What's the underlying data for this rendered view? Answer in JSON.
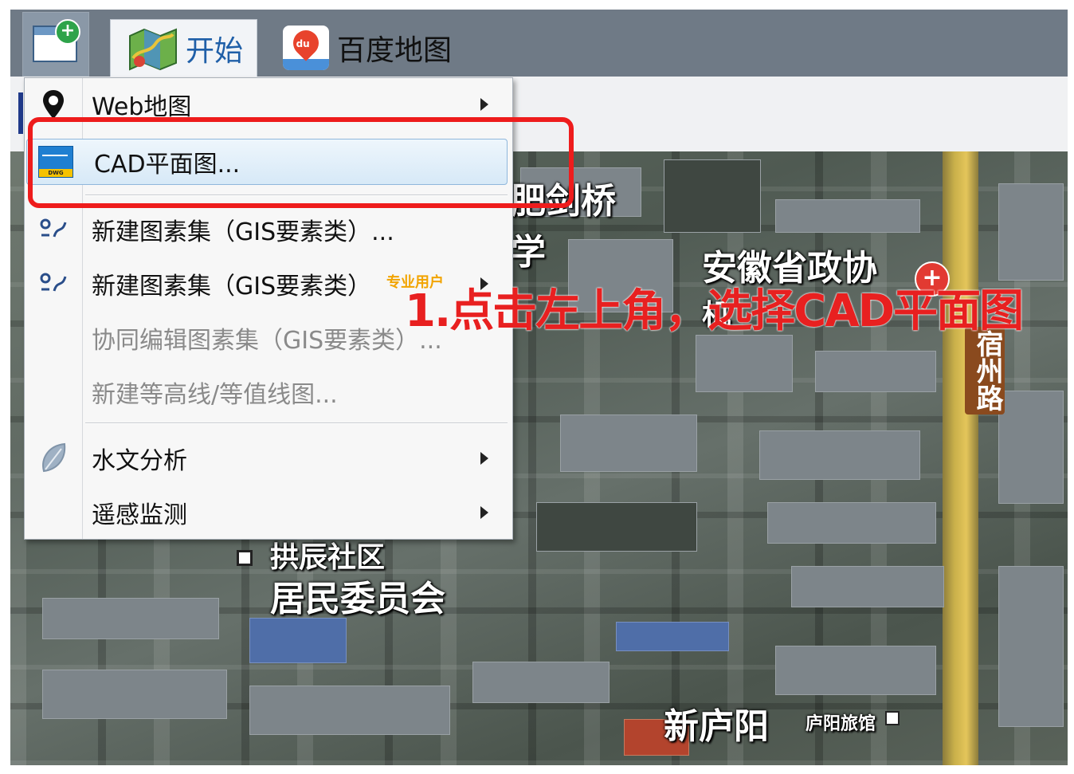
{
  "tabs": {
    "start": "开始",
    "baidu": "百度地图"
  },
  "menu": {
    "web_map": "Web地图",
    "cad_plan": "CAD平面图...",
    "new_feature_set": "新建图素集（GIS要素类）...",
    "new_feature_set_pro": "新建图素集（GIS要素类）",
    "pro_badge": "专业用户",
    "collab_edit": "协同编辑图素集（GIS要素类）...",
    "new_contour": "新建等高线/等值线图...",
    "hydro_analysis": "水文分析",
    "remote_sensing": "遥感监测"
  },
  "annotation": "1.点击左上角，选择CAD平面图",
  "map_labels": {
    "bridge": "肥剑桥",
    "school": "学",
    "cppcc": "安徽省政协",
    "cppcc_sub": "机",
    "road": "宿州路",
    "residents": "居民委员会",
    "community": "拱辰社区",
    "xinluyang": "新庐阳",
    "hotel": "庐阳旅馆"
  },
  "colors": {
    "highlight": "#ee1c1c",
    "annotation": "#e82020",
    "tab_start_text": "#1f5fa8"
  }
}
